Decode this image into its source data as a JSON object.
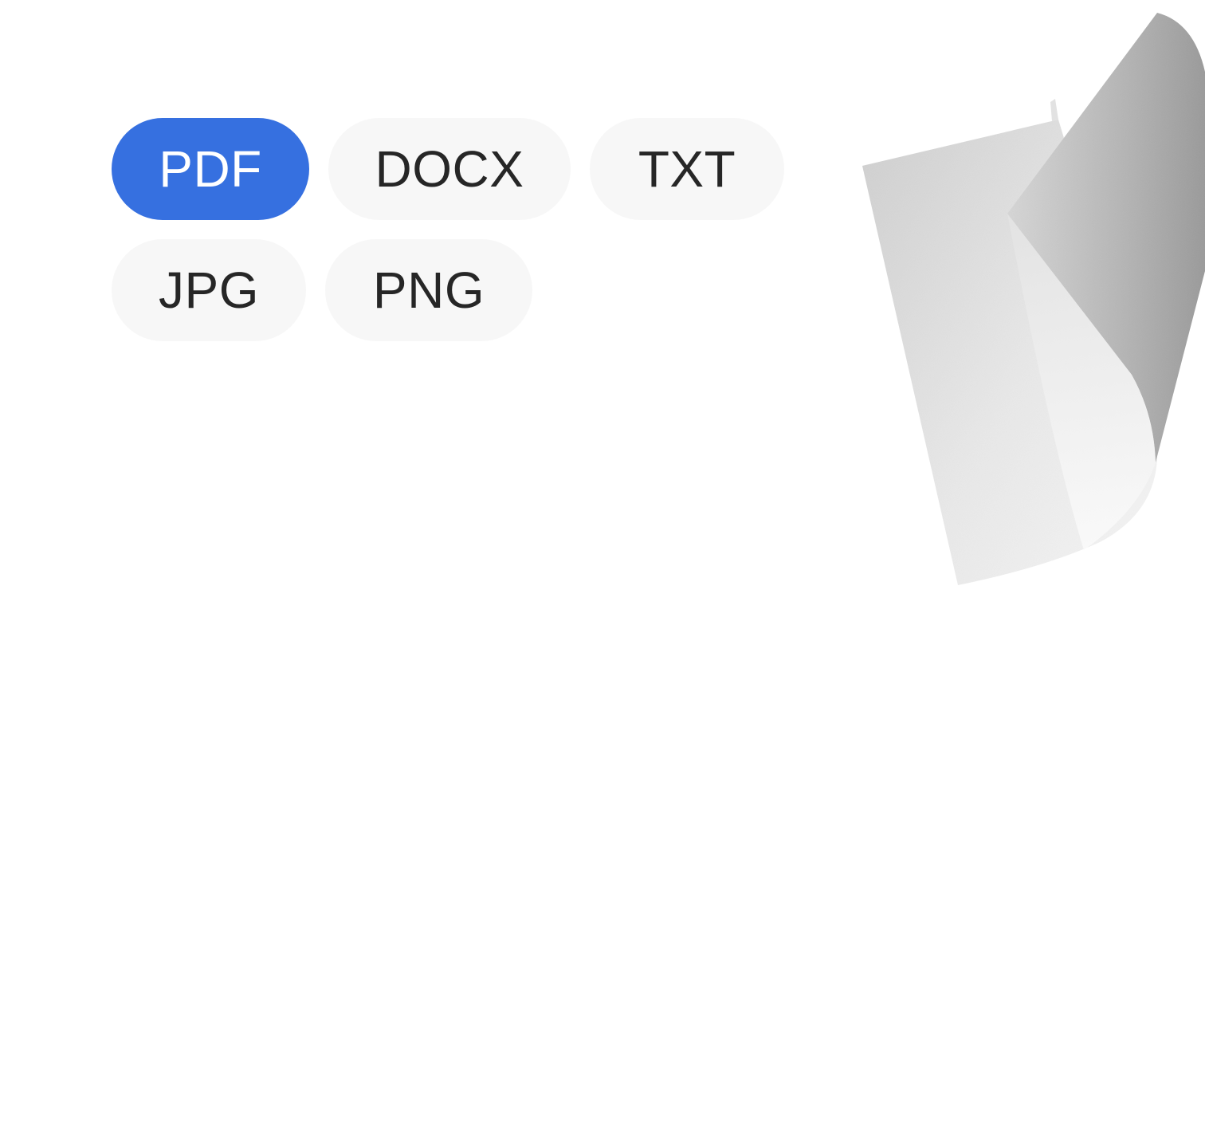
{
  "format_picker": {
    "selected": "PDF",
    "options": [
      {
        "label": "PDF",
        "selected": true
      },
      {
        "label": "DOCX",
        "selected": false
      },
      {
        "label": "TXT",
        "selected": false
      },
      {
        "label": "JPG",
        "selected": false
      },
      {
        "label": "PNG",
        "selected": false
      }
    ]
  },
  "colors": {
    "selected_chip": "#3670e0",
    "chip_background": "#f7f7f7",
    "chip_text": "#262626",
    "selected_text": "#ffffff"
  },
  "illustration": {
    "icon": "curled-paper-document-icon"
  }
}
